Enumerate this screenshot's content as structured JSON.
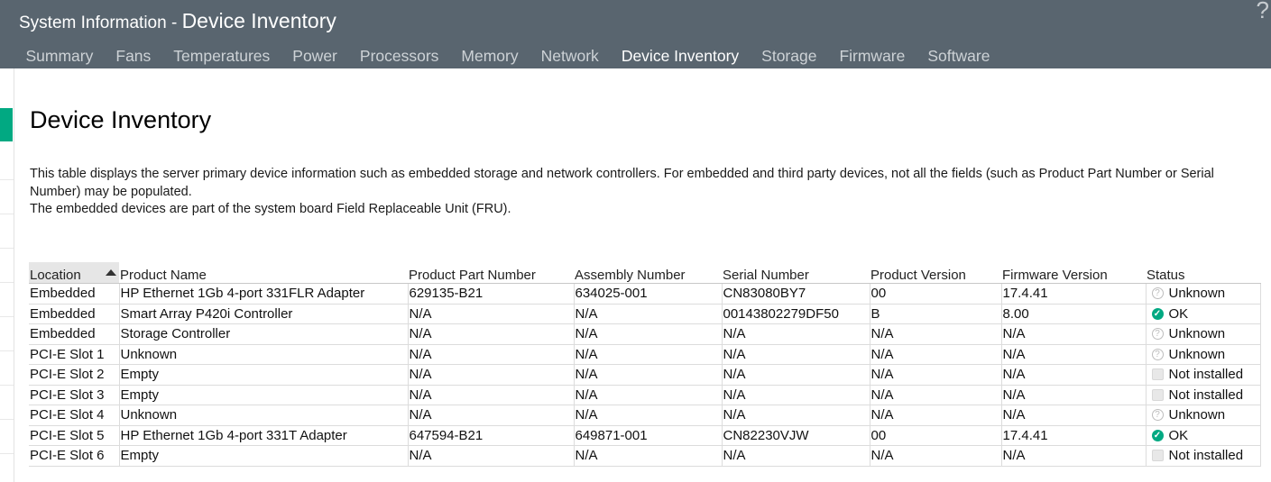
{
  "header": {
    "title_prefix": "System Information - ",
    "title_main": "Device Inventory",
    "help_glyph": "?"
  },
  "tabs": [
    {
      "label": "Summary",
      "active": false
    },
    {
      "label": "Fans",
      "active": false
    },
    {
      "label": "Temperatures",
      "active": false
    },
    {
      "label": "Power",
      "active": false
    },
    {
      "label": "Processors",
      "active": false
    },
    {
      "label": "Memory",
      "active": false
    },
    {
      "label": "Network",
      "active": false
    },
    {
      "label": "Device Inventory",
      "active": true
    },
    {
      "label": "Storage",
      "active": false
    },
    {
      "label": "Firmware",
      "active": false
    },
    {
      "label": "Software",
      "active": false
    }
  ],
  "page": {
    "title": "Device Inventory",
    "description_1": "This table displays the server primary device information such as embedded storage and network controllers. For embedded and third party devices, not all the fields (such as Product Part Number or Serial Number) may be populated.",
    "description_2": "The embedded devices are part of the system board Field Replaceable Unit (FRU)."
  },
  "table": {
    "columns": [
      "Location",
      "Product Name",
      "Product Part Number",
      "Assembly Number",
      "Serial Number",
      "Product Version",
      "Firmware Version",
      "Status"
    ],
    "rows": [
      [
        "Embedded",
        "HP Ethernet 1Gb 4-port 331FLR Adapter",
        "629135-B21",
        "634025-001",
        "CN83080BY7",
        "00",
        "17.4.41",
        "Unknown"
      ],
      [
        "Embedded",
        "Smart Array P420i Controller",
        "N/A",
        "N/A",
        "00143802279DF50",
        "B",
        "8.00",
        "OK"
      ],
      [
        "Embedded",
        "Storage Controller",
        "N/A",
        "N/A",
        "N/A",
        "N/A",
        "N/A",
        "Unknown"
      ],
      [
        "PCI-E Slot 1",
        "Unknown",
        "N/A",
        "N/A",
        "N/A",
        "N/A",
        "N/A",
        "Unknown"
      ],
      [
        "PCI-E Slot 2",
        "Empty",
        "N/A",
        "N/A",
        "N/A",
        "N/A",
        "N/A",
        "Not installed"
      ],
      [
        "PCI-E Slot 3",
        "Empty",
        "N/A",
        "N/A",
        "N/A",
        "N/A",
        "N/A",
        "Not installed"
      ],
      [
        "PCI-E Slot 4",
        "Unknown",
        "N/A",
        "N/A",
        "N/A",
        "N/A",
        "N/A",
        "Unknown"
      ],
      [
        "PCI-E Slot 5",
        "HP Ethernet 1Gb 4-port 331T Adapter",
        "647594-B21",
        "649871-001",
        "CN82230VJW",
        "00",
        "17.4.41",
        "OK"
      ],
      [
        "PCI-E Slot 6",
        "Empty",
        "N/A",
        "N/A",
        "N/A",
        "N/A",
        "N/A",
        "Not installed"
      ]
    ]
  },
  "colors": {
    "header_bg": "#59656f",
    "accent": "#01a982"
  }
}
